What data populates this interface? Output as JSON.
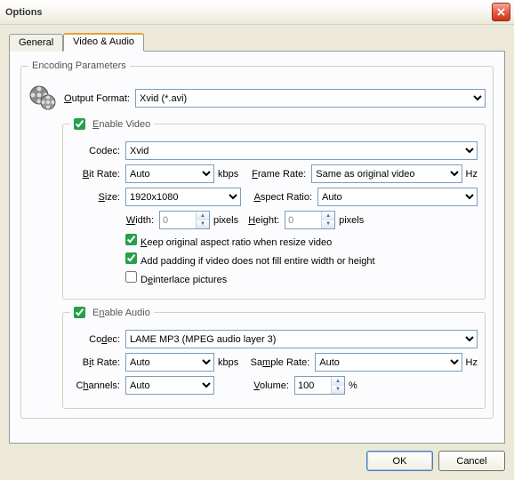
{
  "window": {
    "title": "Options"
  },
  "tabs": {
    "general": "General",
    "videoaudio": "Video & Audio"
  },
  "encoding": {
    "legend": "Encoding Parameters",
    "outputFormat": {
      "label": "Output Format:",
      "value": "Xvid (*.avi)"
    }
  },
  "video": {
    "legend": "Enable Video",
    "codec": {
      "label": "Codec:",
      "value": "Xvid"
    },
    "bitrate": {
      "label": "Bit Rate:",
      "value": "Auto",
      "unit": "kbps"
    },
    "framerate": {
      "label": "Frame Rate:",
      "value": "Same as original video",
      "unit": "Hz"
    },
    "size": {
      "label": "Size:",
      "value": "1920x1080"
    },
    "aspect": {
      "label": "Aspect Ratio:",
      "value": "Auto"
    },
    "width": {
      "label": "Width:",
      "value": "0",
      "unit": "pixels"
    },
    "height": {
      "label": "Height:",
      "value": "0",
      "unit": "pixels"
    },
    "keepAspect": "Keep original aspect ratio when resize video",
    "addPadding": "Add padding if video does not fill entire width or height",
    "deinterlace": "Deinterlace pictures"
  },
  "audio": {
    "legend": "Enable Audio",
    "codec": {
      "label": "Codec:",
      "value": "LAME MP3 (MPEG audio layer 3)"
    },
    "bitrate": {
      "label": "Bit Rate:",
      "value": "Auto",
      "unit": "kbps"
    },
    "samplerate": {
      "label": "Sample Rate:",
      "value": "Auto",
      "unit": "Hz"
    },
    "channels": {
      "label": "Channels:",
      "value": "Auto"
    },
    "volume": {
      "label": "Volume:",
      "value": "100",
      "unit": "%"
    }
  },
  "buttons": {
    "ok": "OK",
    "cancel": "Cancel"
  }
}
